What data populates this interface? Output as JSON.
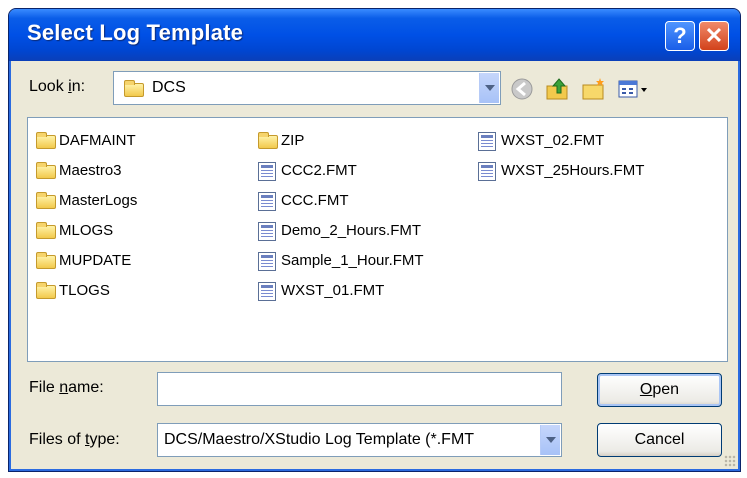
{
  "window": {
    "title": "Select Log Template",
    "help_glyph": "?",
    "close_glyph": "✕"
  },
  "lookin": {
    "label_pre": "Look ",
    "label_key": "i",
    "label_post": "n:",
    "value": "DCS"
  },
  "toolbar": {
    "icons": [
      "back-icon",
      "up-folder-icon",
      "new-folder-icon",
      "view-menu-icon"
    ]
  },
  "files": {
    "col1": [
      "DAFMAINT",
      "Maestro3",
      "MasterLogs",
      "MLOGS",
      "MUPDATE",
      "TLOGS"
    ],
    "col2_folder": "ZIP",
    "col2_files": [
      "CCC2.FMT",
      "CCC.FMT",
      "Demo_2_Hours.FMT",
      "Sample_1_Hour.FMT",
      "WXST_01.FMT"
    ],
    "col3_files": [
      "WXST_02.FMT",
      "WXST_25Hours.FMT"
    ]
  },
  "filename": {
    "label_pre": "File ",
    "label_key": "n",
    "label_post": "ame:",
    "value": ""
  },
  "filetype": {
    "label_pre": "Files of ",
    "label_key": "t",
    "label_post": "ype:",
    "value": "DCS/Maestro/XStudio Log Template (*.FMT"
  },
  "buttons": {
    "open_key": "O",
    "open_rest": "pen",
    "cancel": "Cancel"
  }
}
